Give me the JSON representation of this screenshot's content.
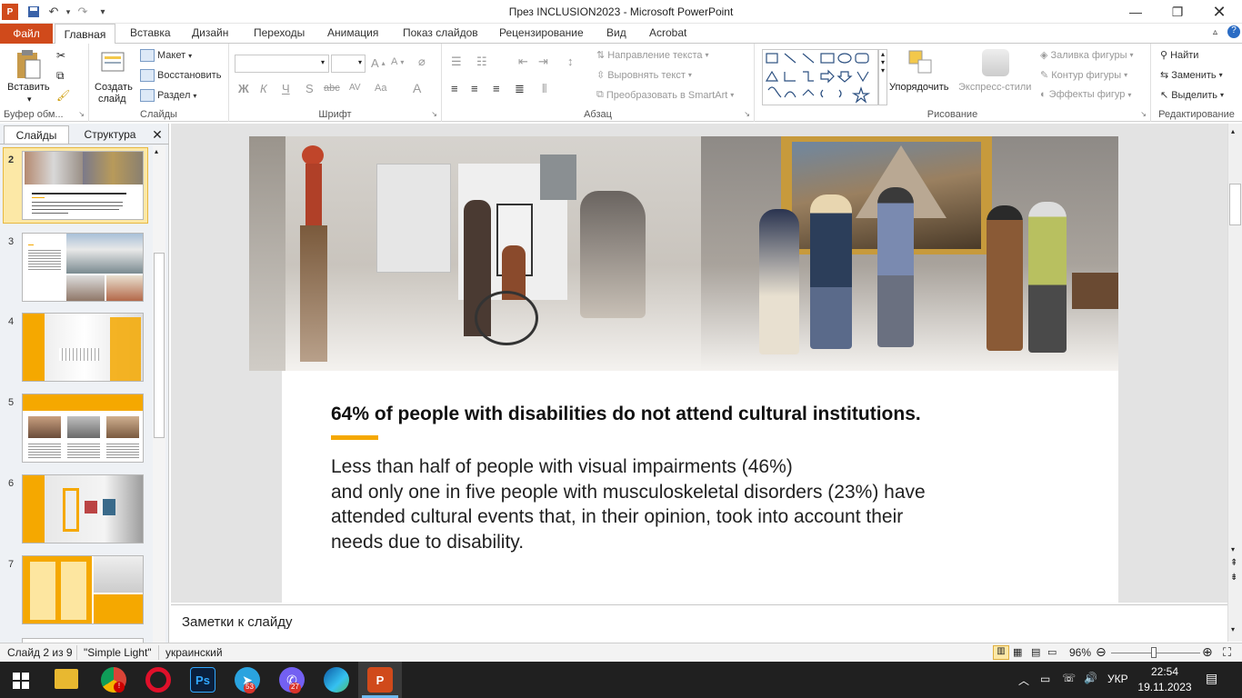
{
  "window": {
    "title": "През INCLUSION2023  -  Microsoft PowerPoint"
  },
  "quick_access": {
    "app_icon": "powerpoint-icon",
    "save_icon": "save-icon",
    "undo_icon": "undo-icon",
    "redo_icon": "redo-icon"
  },
  "tabs": {
    "file": "Файл",
    "items": [
      "Главная",
      "Вставка",
      "Дизайн",
      "Переходы",
      "Анимация",
      "Показ слайдов",
      "Рецензирование",
      "Вид",
      "Acrobat"
    ]
  },
  "ribbon": {
    "clipboard": {
      "label": "Буфер обм...",
      "paste": "Вставить"
    },
    "slides": {
      "label": "Слайды",
      "new_slide_1": "Создать",
      "new_slide_2": "слайд",
      "layout": "Макет",
      "reset": "Восстановить",
      "section": "Раздел"
    },
    "font": {
      "label": "Шрифт",
      "bold": "Ж",
      "italic": "К",
      "underline": "Ч",
      "shadow": "S",
      "strike": "abc",
      "spacing": "AV",
      "case": "Aa",
      "color": "A"
    },
    "paragraph": {
      "label": "Абзац",
      "text_direction": "Направление текста",
      "align_text": "Выровнять текст",
      "smartart": "Преобразовать в SmartArt"
    },
    "drawing": {
      "label": "Рисование",
      "arrange": "Упорядочить",
      "quick_styles": "Экспресс-стили",
      "fill": "Заливка фигуры",
      "outline": "Контур фигуры",
      "effects": "Эффекты фигур"
    },
    "editing": {
      "label": "Редактирование",
      "find": "Найти",
      "replace": "Заменить",
      "select": "Выделить"
    }
  },
  "panel": {
    "tab_slides": "Слайды",
    "tab_outline": "Структура",
    "thumbnails": [
      {
        "num": "2"
      },
      {
        "num": "3"
      },
      {
        "num": "4"
      },
      {
        "num": "5"
      },
      {
        "num": "6"
      },
      {
        "num": "7"
      }
    ]
  },
  "slide": {
    "heading": "64% of people with disabilities do not attend cultural institutions.",
    "body_lines": [
      "Less than half of people with  visual impairments  (46%)",
      "and only one in five people with musculoskeletal disorders (23%) have",
      "attended cultural events that, in their opinion, took into account their",
      "needs due to disability."
    ],
    "accent_color": "#f5a800"
  },
  "notes": {
    "placeholder": "Заметки к слайду"
  },
  "status": {
    "slide_counter": "Слайд 2 из 9",
    "theme": "\"Simple Light\"",
    "language": "украинский",
    "zoom": "96%"
  },
  "taskbar": {
    "telegram_badge": "53",
    "viber_badge": "27",
    "lang": "УКР",
    "time": "22:54",
    "date": "19.11.2023"
  }
}
